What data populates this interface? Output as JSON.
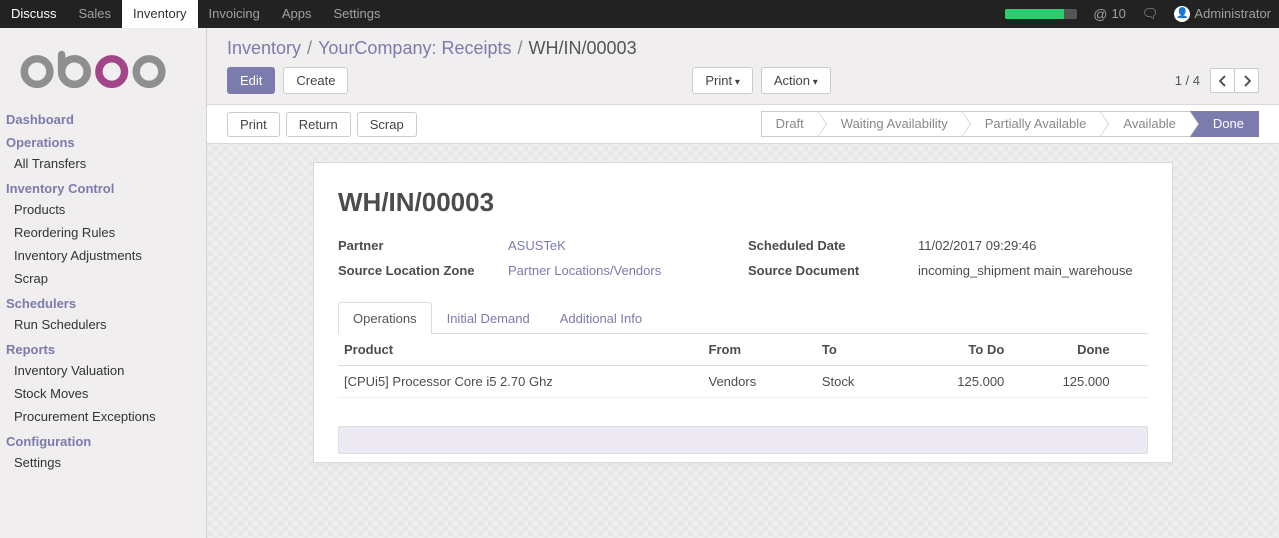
{
  "topnav": {
    "items": [
      "Discuss",
      "Sales",
      "Inventory",
      "Invoicing",
      "Apps",
      "Settings"
    ],
    "active_index": 2,
    "notif_count": "10",
    "user_name": "Administrator"
  },
  "sidebar": {
    "sections": [
      {
        "title": "Dashboard",
        "items": []
      },
      {
        "title": "Operations",
        "items": [
          "All Transfers"
        ]
      },
      {
        "title": "Inventory Control",
        "items": [
          "Products",
          "Reordering Rules",
          "Inventory Adjustments",
          "Scrap"
        ]
      },
      {
        "title": "Schedulers",
        "items": [
          "Run Schedulers"
        ]
      },
      {
        "title": "Reports",
        "items": [
          "Inventory Valuation",
          "Stock Moves",
          "Procurement Exceptions"
        ]
      },
      {
        "title": "Configuration",
        "items": [
          "Settings"
        ]
      }
    ]
  },
  "breadcrumb": {
    "parts": [
      "Inventory",
      "YourCompany: Receipts",
      "WH/IN/00003"
    ]
  },
  "controls": {
    "edit": "Edit",
    "create": "Create",
    "print": "Print",
    "action": "Action"
  },
  "pager": {
    "text": "1 / 4"
  },
  "status_actions": {
    "print": "Print",
    "return": "Return",
    "scrap": "Scrap"
  },
  "status_steps": [
    "Draft",
    "Waiting Availability",
    "Partially Available",
    "Available",
    "Done"
  ],
  "status_active_index": 4,
  "form": {
    "title": "WH/IN/00003",
    "labels": {
      "partner": "Partner",
      "source_location": "Source Location Zone",
      "scheduled_date": "Scheduled Date",
      "source_document": "Source Document"
    },
    "values": {
      "partner": "ASUSTeK",
      "source_location": "Partner Locations/Vendors",
      "scheduled_date": "11/02/2017 09:29:46",
      "source_document": "incoming_shipment main_warehouse"
    }
  },
  "tabs": {
    "items": [
      "Operations",
      "Initial Demand",
      "Additional Info"
    ],
    "active_index": 0
  },
  "table": {
    "headers": {
      "product": "Product",
      "from": "From",
      "to": "To",
      "todo": "To Do",
      "done": "Done"
    },
    "rows": [
      {
        "product": "[CPUi5] Processor Core i5 2.70 Ghz",
        "from": "Vendors",
        "to": "Stock",
        "todo": "125.000",
        "done": "125.000"
      }
    ]
  }
}
